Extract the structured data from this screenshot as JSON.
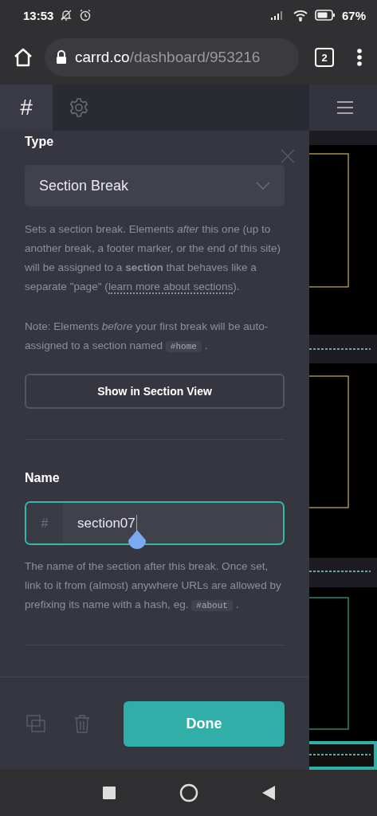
{
  "status_bar": {
    "time": "13:53",
    "battery": "67%"
  },
  "browser": {
    "url_host": "carrd.co",
    "url_path": "/dashboard/953216",
    "tab_count": "2"
  },
  "toolbar": {
    "tabs": [
      {
        "kind": "hash",
        "label": "#",
        "selected": true
      },
      {
        "kind": "gear",
        "selected": false
      }
    ]
  },
  "panel": {
    "type_label": "Type",
    "type_select": {
      "value": "Section Break"
    },
    "type_help": [
      {
        "kind": "text",
        "text": "Sets a section break. Elements *after* this one (up to another break, a footer marker, or the end of this site) will be assigned to a **section** that behaves like a separate \"page\" ("
      },
      {
        "kind": "link",
        "text": "learn more about sections"
      },
      {
        "kind": "text",
        "text": ")."
      }
    ],
    "note": [
      {
        "kind": "text",
        "text": "Note: Elements *before* your first break will be auto-assigned to a section named "
      },
      {
        "kind": "code",
        "text": "#home"
      },
      {
        "kind": "text",
        "text": " ."
      }
    ],
    "section_view_button": "Show in Section View",
    "name_label": "Name",
    "name_field": {
      "prefix": "#",
      "value": "section07",
      "focused": true
    },
    "name_help": [
      {
        "kind": "text",
        "text": "The name of the section after this break. Once set, link to it from (almost) anywhere URLs are allowed by prefixing its name with a hash, eg. "
      },
      {
        "kind": "code",
        "text": "#about"
      },
      {
        "kind": "text",
        "text": " ."
      }
    ],
    "done_button": "Done"
  }
}
